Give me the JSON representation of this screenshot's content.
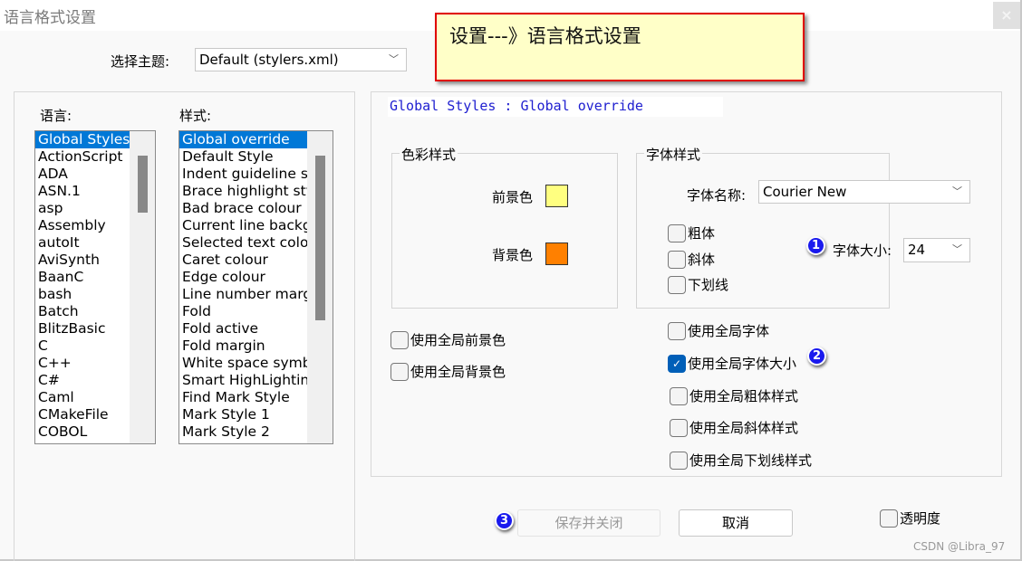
{
  "window": {
    "title": "语言格式设置",
    "close_label": "×"
  },
  "annotation": {
    "text": "设置---》语言格式设置",
    "border_color": "#e00000",
    "background": "#ffffc8"
  },
  "theme": {
    "label": "选择主题:",
    "value": "Default (stylers.xml)"
  },
  "languages": {
    "label": "语言:",
    "selected": "Global Styles",
    "items": [
      "Global Styles",
      "ActionScript",
      "ADA",
      "ASN.1",
      "asp",
      "Assembly",
      "autoIt",
      "AviSynth",
      "BaanC",
      "bash",
      "Batch",
      "BlitzBasic",
      "C",
      "C++",
      "C#",
      "Caml",
      "CMakeFile",
      "COBOL"
    ]
  },
  "styles": {
    "label": "样式:",
    "selected": "Global override",
    "items": [
      "Global override",
      "Default Style",
      "Indent guideline sty",
      "Brace highlight style",
      "Bad brace colour",
      "Current line backgro",
      "Selected text colour",
      "Caret colour",
      "Edge colour",
      "Line number margin",
      "Fold",
      "Fold active",
      "Fold margin",
      "White space symbol",
      "Smart HighLighting",
      "Find Mark Style",
      "Mark Style 1",
      "Mark Style 2"
    ]
  },
  "preview": {
    "text": "Global Styles : Global override",
    "color": "#2020d0"
  },
  "color_group": {
    "title": "色彩样式",
    "foreground_label": "前景色",
    "foreground_color": "#ffff80",
    "background_label": "背景色",
    "background_color": "#ff8000"
  },
  "font_group": {
    "title": "字体样式",
    "font_name_label": "字体名称:",
    "font_name_value": "Courier New",
    "bold_label": "粗体",
    "bold_checked": false,
    "italic_label": "斜体",
    "italic_checked": false,
    "underline_label": "下划线",
    "underline_checked": false,
    "font_size_label": "字体大小:",
    "font_size_value": "24"
  },
  "global_options": {
    "use_global_fg": {
      "label": "使用全局前景色",
      "checked": false
    },
    "use_global_bg": {
      "label": "使用全局背景色",
      "checked": false
    },
    "use_global_font": {
      "label": "使用全局字体",
      "checked": false
    },
    "use_global_font_size": {
      "label": "使用全局字体大小",
      "checked": true
    },
    "use_global_bold": {
      "label": "使用全局粗体样式",
      "checked": false
    },
    "use_global_italic": {
      "label": "使用全局斜体样式",
      "checked": false
    },
    "use_global_underline": {
      "label": "使用全局下划线样式",
      "checked": false
    }
  },
  "badges": [
    "1",
    "2",
    "3"
  ],
  "buttons": {
    "save_close": "保存并关闭",
    "cancel": "取消"
  },
  "transparency": {
    "label": "透明度",
    "checked": false
  },
  "watermark": "CSDN @Libra_97"
}
